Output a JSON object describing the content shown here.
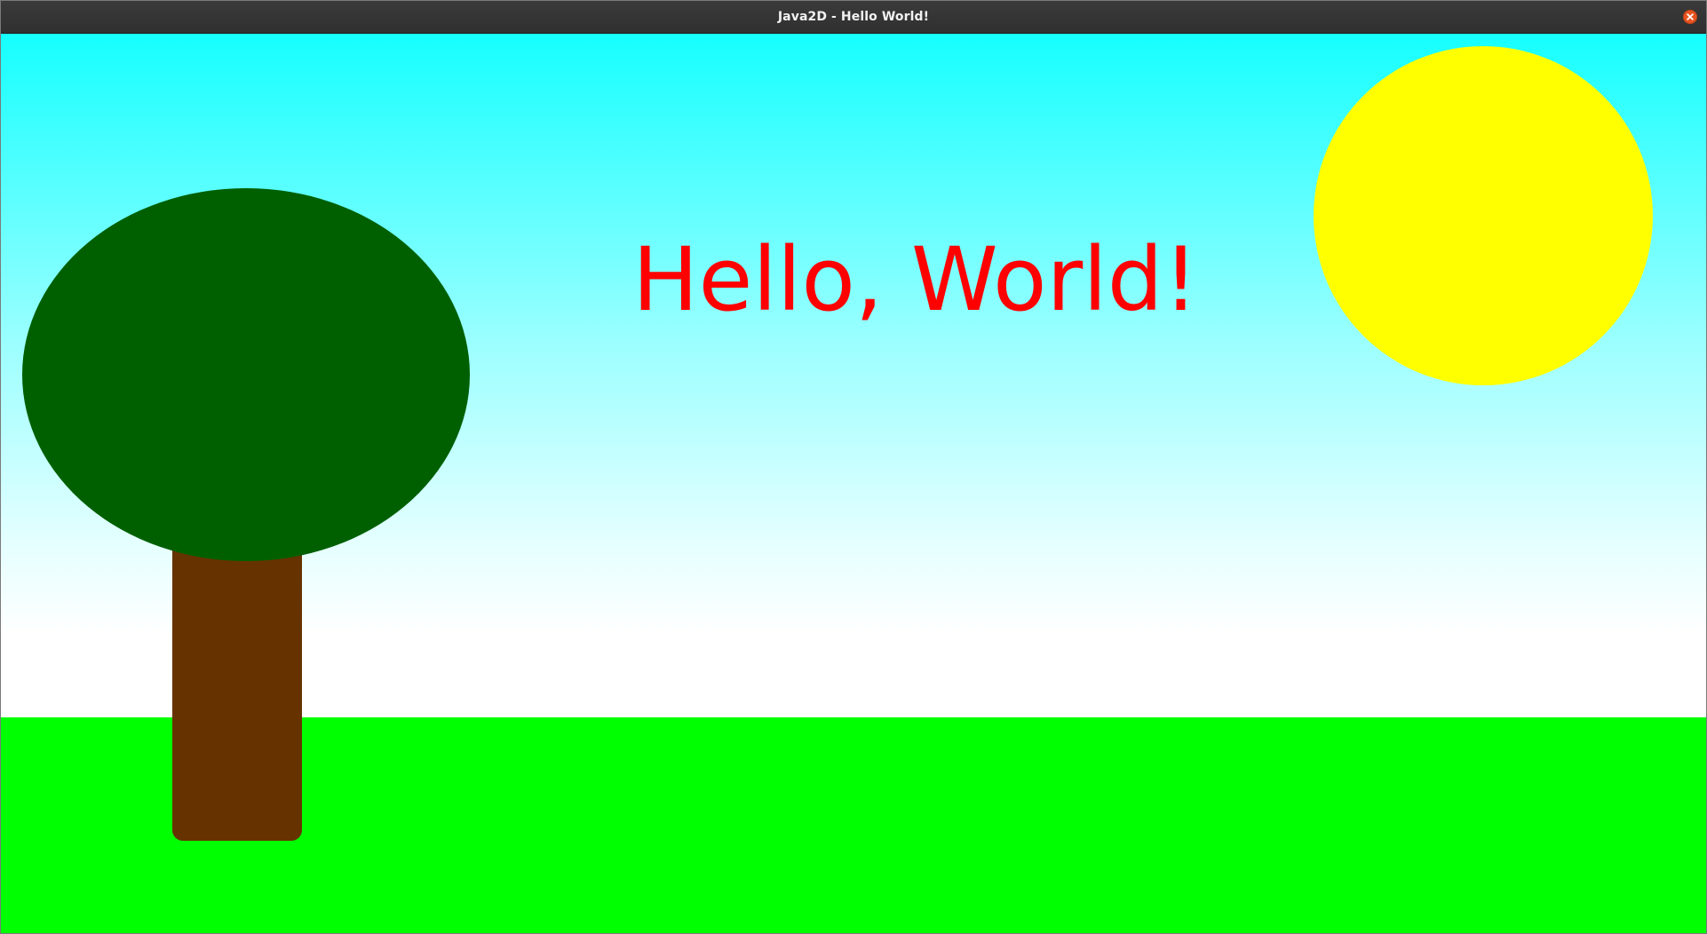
{
  "window": {
    "title": "Java2D - Hello World!",
    "close_icon": "close-icon",
    "close_color": "#e95420"
  },
  "scene": {
    "greeting": "Hello, World!",
    "colors": {
      "sky_top": "#16ffff",
      "sky_bottom": "#ffffff",
      "ground": "#00ff00",
      "sun": "#ffff00",
      "tree_canopy": "#006000",
      "tree_trunk": "#663300",
      "greeting_text": "#ff0000"
    }
  }
}
